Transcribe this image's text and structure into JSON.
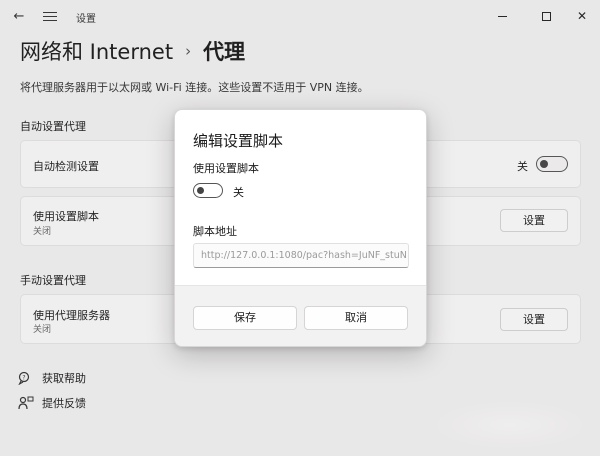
{
  "window": {
    "title": "设置",
    "back_glyph": "←",
    "minimize_label": "",
    "maximize_label": "",
    "close_glyph": "✕"
  },
  "breadcrumb": {
    "parent": "网络和 Internet",
    "separator": "›",
    "current": "代理"
  },
  "description": "将代理服务器用于以太网或 Wi-Fi 连接。这些设置不适用于 VPN 连接。",
  "auto_section": {
    "title": "自动设置代理",
    "auto_detect": {
      "label": "自动检测设置",
      "state_text": "关",
      "enabled": false
    },
    "setup_script": {
      "label": "使用设置脚本",
      "sub": "关闭",
      "button": "设置"
    }
  },
  "manual_section": {
    "title": "手动设置代理",
    "proxy_server": {
      "label": "使用代理服务器",
      "sub": "关闭",
      "button": "设置"
    }
  },
  "help_links": {
    "get_help": {
      "label": "获取帮助",
      "icon": "help-chat-icon"
    },
    "feedback": {
      "label": "提供反馈",
      "icon": "feedback-person-icon"
    }
  },
  "dialog": {
    "title": "编辑设置脚本",
    "use_script_label": "使用设置脚本",
    "toggle_state_text": "关",
    "toggle_enabled": false,
    "address_label": "脚本地址",
    "address_placeholder": "http://127.0.0.1:1080/pac?hash=JuNF_stuN",
    "save_label": "保存",
    "cancel_label": "取消"
  },
  "colors": {
    "window_bg": "#f4f2f2",
    "card_bg": "#fbfafa",
    "dialog_bg": "#ffffff",
    "dialog_footer_bg": "#f3f2f2"
  }
}
